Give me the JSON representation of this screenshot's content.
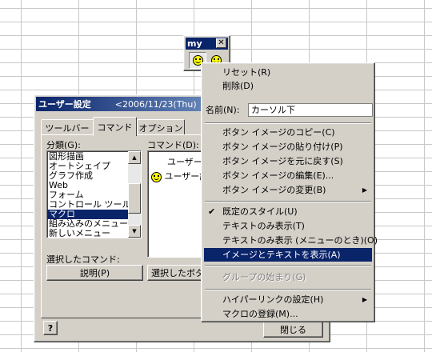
{
  "toolbar": {
    "title": "my",
    "close": "✕"
  },
  "dialog": {
    "title": "ユーザー設定",
    "title_date": "<2006/11/23(Thu)",
    "tabs": [
      "ツールバー",
      "コマンド",
      "オプション"
    ],
    "category_label": "分類(G):",
    "command_label": "コマンド(D):",
    "categories": [
      "図形描画",
      "オートシェイプ",
      "グラフ作成",
      "Web",
      "フォーム",
      "コントロール ツールボ",
      "マクロ",
      "組み込みのメニュー",
      "新しいメニュー"
    ],
    "selected_category": "マクロ",
    "commands": [
      "ユーザー設",
      "ユーザー設"
    ],
    "selected_command_label": "選択したコマンド:",
    "describe_button": "説明(P)",
    "modify_button": "選択したボタン",
    "close_button": "閉じる",
    "help_button": "?"
  },
  "menu": {
    "reset": "リセット(R)",
    "delete": "削除(D)",
    "name_label": "名前(N):",
    "name_value": "カーソル下",
    "copy_image": "ボタン イメージのコピー(C)",
    "paste_image": "ボタン イメージの貼り付け(P)",
    "restore_image": "ボタン イメージを元に戻す(S)",
    "edit_image": "ボタン イメージの編集(E)...",
    "change_image": "ボタン イメージの変更(B)",
    "default_style": "既定のスタイル(U)",
    "text_only": "テキストのみ表示(T)",
    "text_only_menu": "テキストのみ表示 (メニューのとき)(O)",
    "image_and_text": "イメージとテキストを表示(A)",
    "begin_group": "グループの始まり(G)",
    "hyperlink": "ハイパーリンクの設定(H)",
    "assign_macro": "マクロの登録(M)..."
  }
}
